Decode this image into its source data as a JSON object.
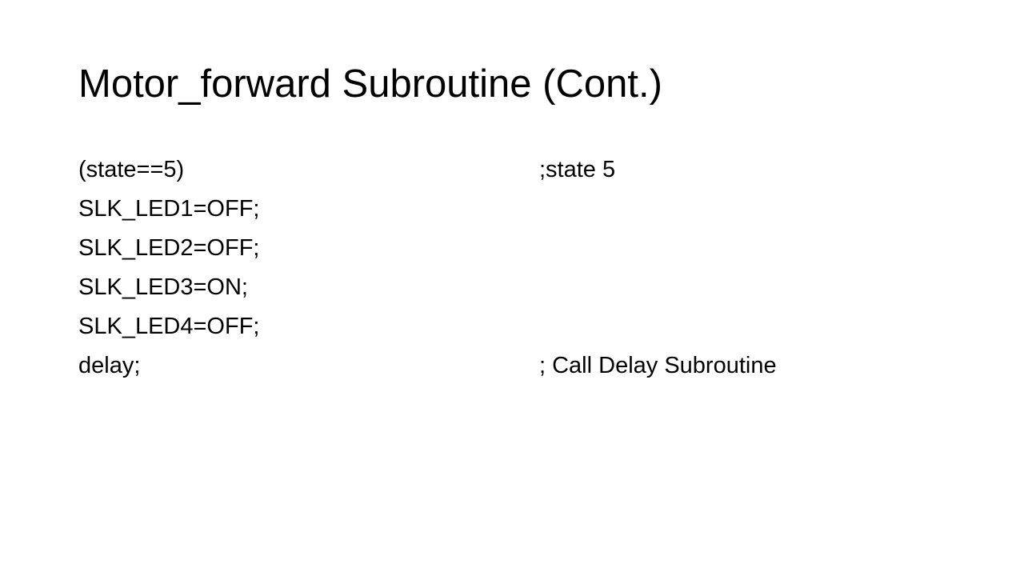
{
  "slide": {
    "title": "Motor_forward Subroutine (Cont.)",
    "lines": [
      {
        "code": "(state==5)",
        "comment": ";state 5"
      },
      {
        "code": "SLK_LED1=OFF;",
        "comment": ""
      },
      {
        "code": "SLK_LED2=OFF;",
        "comment": ""
      },
      {
        "code": "SLK_LED3=ON;",
        "comment": ""
      },
      {
        "code": "SLK_LED4=OFF;",
        "comment": ""
      },
      {
        "code": "delay;",
        "comment": "; Call Delay Subroutine"
      }
    ]
  }
}
